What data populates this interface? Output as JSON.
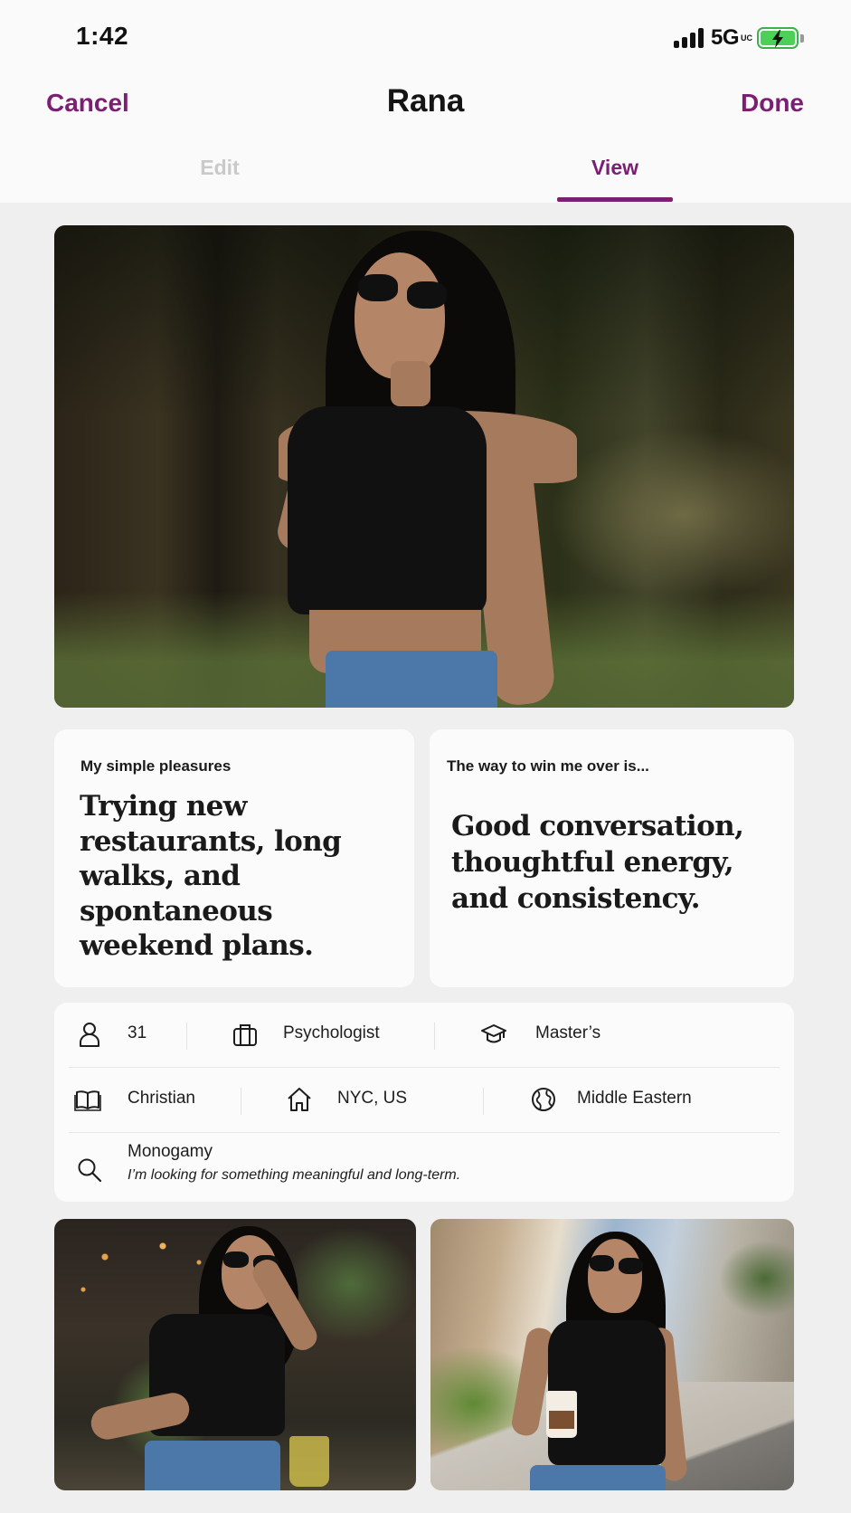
{
  "status_bar": {
    "time": "1:42",
    "network": "5G",
    "network_sub": "UC",
    "battery_color": "#4cd05a"
  },
  "nav": {
    "cancel_label": "Cancel",
    "title": "Rana",
    "done_label": "Done",
    "accent_color": "#7a1f72"
  },
  "tabs": [
    {
      "label": "Edit",
      "active": false
    },
    {
      "label": "View",
      "active": true
    }
  ],
  "prompts": [
    {
      "question": "My simple pleasures",
      "answer": "Trying new restaurants, long walks, and spontaneous weekend plans."
    },
    {
      "question": "The way to win me over is...",
      "answer": "Good conversation, thoughtful energy, and consistency."
    }
  ],
  "info": {
    "age": "31",
    "job": "Psychologist",
    "education": "Master’s",
    "religion": "Christian",
    "location": "NYC, US",
    "ethnicity": "Middle Eastern",
    "relationship_type": "Monogamy",
    "relationship_goal": "I’m looking for something meaningful and long-term."
  },
  "icons": {
    "age": "person-icon",
    "job": "briefcase-icon",
    "education": "graduation-cap-icon",
    "religion": "book-icon",
    "location": "home-icon",
    "ethnicity": "globe-icon",
    "relationship": "search-icon"
  }
}
